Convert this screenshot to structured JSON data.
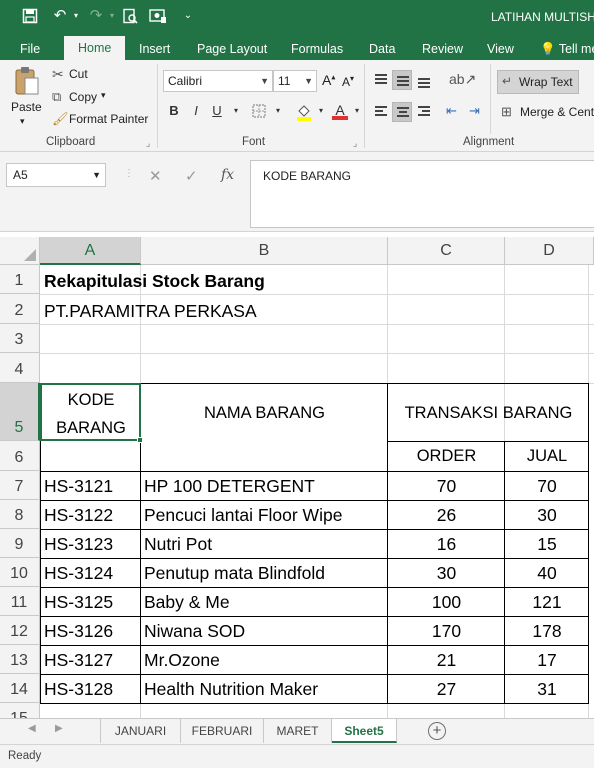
{
  "window": {
    "title": "LATIHAN MULTISHE"
  },
  "tabs": [
    "File",
    "Home",
    "Insert",
    "Page Layout",
    "Formulas",
    "Data",
    "Review",
    "View",
    "Tell me"
  ],
  "ribbon": {
    "clipboard": {
      "paste": "Paste",
      "cut": "Cut",
      "copy": "Copy",
      "format_painter": "Format Painter",
      "group": "Clipboard"
    },
    "font": {
      "name": "Calibri",
      "size": "11",
      "bold": "B",
      "italic": "I",
      "underline": "U",
      "group": "Font"
    },
    "alignment": {
      "wrap_text": "Wrap Text",
      "merge": "Merge & Cent",
      "group": "Alignment"
    }
  },
  "formula_bar": {
    "name_box": "A5",
    "formula": "KODE BARANG",
    "fx": "fx"
  },
  "columns": [
    "A",
    "B",
    "C",
    "D"
  ],
  "rows": [
    "1",
    "2",
    "3",
    "4",
    "5",
    "6",
    "7",
    "8",
    "9",
    "10",
    "11",
    "12",
    "13",
    "14",
    "15"
  ],
  "sheet": {
    "title": "Rekapitulasi Stock Barang",
    "company": "PT.PARAMITRA PERKASA",
    "header": {
      "kode_line1": "KODE",
      "kode_line2": "BARANG",
      "nama": "NAMA BARANG",
      "transaksi": "TRANSAKSI BARANG",
      "order": "ORDER",
      "jual": "JUAL"
    },
    "items": [
      {
        "kode": "HS-3121",
        "nama": "HP 100 DETERGENT",
        "order": "70",
        "jual": "70"
      },
      {
        "kode": "HS-3122",
        "nama": "Pencuci lantai Floor Wipe",
        "order": "26",
        "jual": "30"
      },
      {
        "kode": "HS-3123",
        "nama": "Nutri Pot",
        "order": "16",
        "jual": "15"
      },
      {
        "kode": "HS-3124",
        "nama": "Penutup mata Blindfold",
        "order": "30",
        "jual": "40"
      },
      {
        "kode": "HS-3125",
        "nama": "Baby & Me",
        "order": "100",
        "jual": "121"
      },
      {
        "kode": "HS-3126",
        "nama": "Niwana SOD",
        "order": "170",
        "jual": "178"
      },
      {
        "kode": "HS-3127",
        "nama": "Mr.Ozone",
        "order": "21",
        "jual": "17"
      },
      {
        "kode": "HS-3128",
        "nama": "Health Nutrition Maker",
        "order": "27",
        "jual": "31"
      }
    ]
  },
  "sheet_tabs": [
    "JANUARI",
    "FEBRUARI",
    "MARET",
    "Sheet5"
  ],
  "status": "Ready",
  "colors": {
    "accent": "#217346"
  }
}
